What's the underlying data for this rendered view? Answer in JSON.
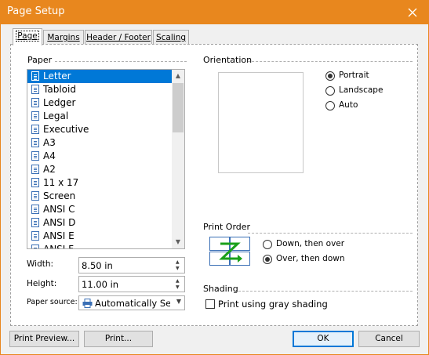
{
  "window": {
    "title": "Page Setup"
  },
  "tabs": [
    {
      "label": "Page"
    },
    {
      "label": "Margins"
    },
    {
      "label": "Header / Footer"
    },
    {
      "label": "Scaling"
    }
  ],
  "paper": {
    "group_label": "Paper",
    "items": [
      "Letter",
      "Tabloid",
      "Ledger",
      "Legal",
      "Executive",
      "A3",
      "A4",
      "A2",
      "11 x 17",
      "Screen",
      "ANSI C",
      "ANSI D",
      "ANSI E",
      "ANSI F"
    ],
    "selected": "Letter",
    "width_label": "Width:",
    "width_value": "8.50 in",
    "height_label": "Height:",
    "height_value": "11.00 in",
    "source_label": "Paper source:",
    "source_value": "Automatically Select"
  },
  "orientation": {
    "group_label": "Orientation",
    "options": [
      "Portrait",
      "Landscape",
      "Auto"
    ],
    "selected": "Portrait"
  },
  "print_order": {
    "group_label": "Print Order",
    "options": [
      "Down, then over",
      "Over, then down"
    ],
    "selected": "Over, then down"
  },
  "shading": {
    "group_label": "Shading",
    "checkbox_label": "Print using gray shading",
    "checked": false
  },
  "buttons": {
    "print_preview": "Print Preview...",
    "print": "Print...",
    "ok": "OK",
    "cancel": "Cancel"
  },
  "colors": {
    "titlebar": "#e8871e",
    "selection": "#0078d7",
    "print_order_arrow": "#1aa01a"
  }
}
